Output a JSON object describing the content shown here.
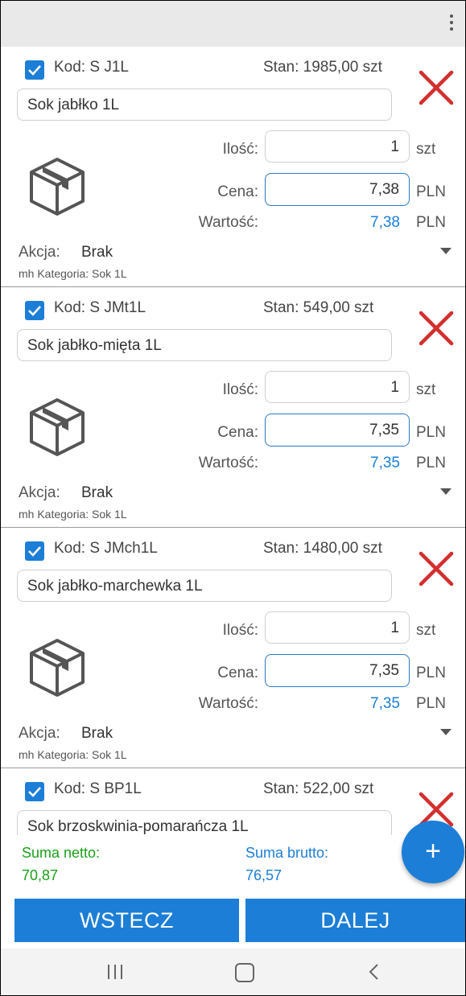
{
  "products": [
    {
      "kod": "Kod: S J1L",
      "stan": "Stan: 1985,00 szt",
      "name": "Sok jabłko 1L",
      "ilosc_label": "Ilość:",
      "ilosc": "1",
      "ilosc_unit": "szt",
      "cena_label": "Cena:",
      "cena": "7,38",
      "cena_unit": "PLN",
      "wartosc_label": "Wartość:",
      "wartosc": "7,38",
      "wartosc_unit": "PLN",
      "akcja_label": "Akcja:",
      "akcja": "Brak",
      "kategoria": "mh Kategoria: Sok 1L"
    },
    {
      "kod": "Kod: S JMt1L",
      "stan": "Stan: 549,00 szt",
      "name": "Sok jabłko-mięta 1L",
      "ilosc_label": "Ilość:",
      "ilosc": "1",
      "ilosc_unit": "szt",
      "cena_label": "Cena:",
      "cena": "7,35",
      "cena_unit": "PLN",
      "wartosc_label": "Wartość:",
      "wartosc": "7,35",
      "wartosc_unit": "PLN",
      "akcja_label": "Akcja:",
      "akcja": "Brak",
      "kategoria": "mh Kategoria: Sok 1L"
    },
    {
      "kod": "Kod: S JMch1L",
      "stan": "Stan: 1480,00 szt",
      "name": "Sok jabłko-marchewka 1L",
      "ilosc_label": "Ilość:",
      "ilosc": "1",
      "ilosc_unit": "szt",
      "cena_label": "Cena:",
      "cena": "7,35",
      "cena_unit": "PLN",
      "wartosc_label": "Wartość:",
      "wartosc": "7,35",
      "wartosc_unit": "PLN",
      "akcja_label": "Akcja:",
      "akcja": "Brak",
      "kategoria": "mh Kategoria: Sok 1L"
    },
    {
      "kod": "Kod: S BP1L",
      "stan": "Stan: 522,00 szt",
      "name": "Sok brzoskwinia-pomarańcza 1L"
    }
  ],
  "summary": {
    "netto_label": "Suma netto:",
    "netto_value": "70,87",
    "brutto_label": "Suma brutto:",
    "brutto_value": "76,57"
  },
  "fab": {
    "label": "+"
  },
  "buttons": {
    "back": "WSTECZ",
    "next": "DALEJ"
  },
  "colors": {
    "accent": "#1c7ed6",
    "delete": "#d32f2f",
    "netto": "#1aa11a"
  }
}
